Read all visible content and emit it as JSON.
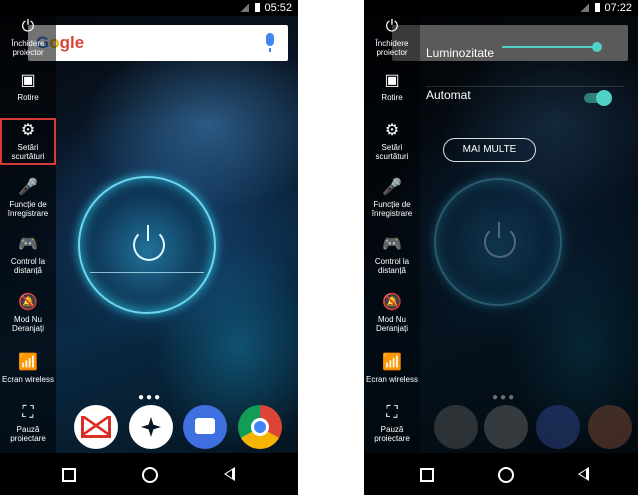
{
  "left_phone": {
    "status": {
      "time": "05:52"
    },
    "search": {
      "logo": "gle"
    },
    "sidebar": [
      {
        "label": "Închidere proiector",
        "icon": "power-icon"
      },
      {
        "label": "Rotire",
        "icon": "rotate-icon"
      },
      {
        "label": "Setări scurtături",
        "icon": "gear-icon",
        "selected": true
      },
      {
        "label": "Funcție de înregistrare",
        "icon": "mic-icon"
      },
      {
        "label": "Control la distanță",
        "icon": "gamepad-icon"
      },
      {
        "label": "Mod Nu Deranjați",
        "icon": "bell-off-icon"
      },
      {
        "label": "Ecran wireless",
        "icon": "wireless-icon"
      },
      {
        "label": "Pauză proiectare",
        "icon": "pause-projection-icon"
      }
    ],
    "dock": [
      "gmail-icon",
      "compass-icon",
      "messages-icon",
      "chrome-icon"
    ]
  },
  "right_phone": {
    "status": {
      "time": "07:22"
    },
    "brightness_label": "Luminozitate",
    "auto_label": "Automat",
    "auto_on": true,
    "more_button": "MAI MULTE",
    "sidebar": [
      {
        "label": "Închidere proiector",
        "icon": "power-icon"
      },
      {
        "label": "Rotire",
        "icon": "rotate-icon"
      },
      {
        "label": "Setări scurtături",
        "icon": "gear-icon"
      },
      {
        "label": "Funcție de înregistrare",
        "icon": "mic-icon"
      },
      {
        "label": "Control la distanță",
        "icon": "gamepad-icon"
      },
      {
        "label": "Mod Nu Deranjați",
        "icon": "bell-off-icon"
      },
      {
        "label": "Ecran wireless",
        "icon": "wireless-icon"
      },
      {
        "label": "Pauză proiectare",
        "icon": "pause-projection-icon"
      }
    ]
  },
  "colors": {
    "accent": "#4fd1c5",
    "highlight": "#d83a3a"
  }
}
